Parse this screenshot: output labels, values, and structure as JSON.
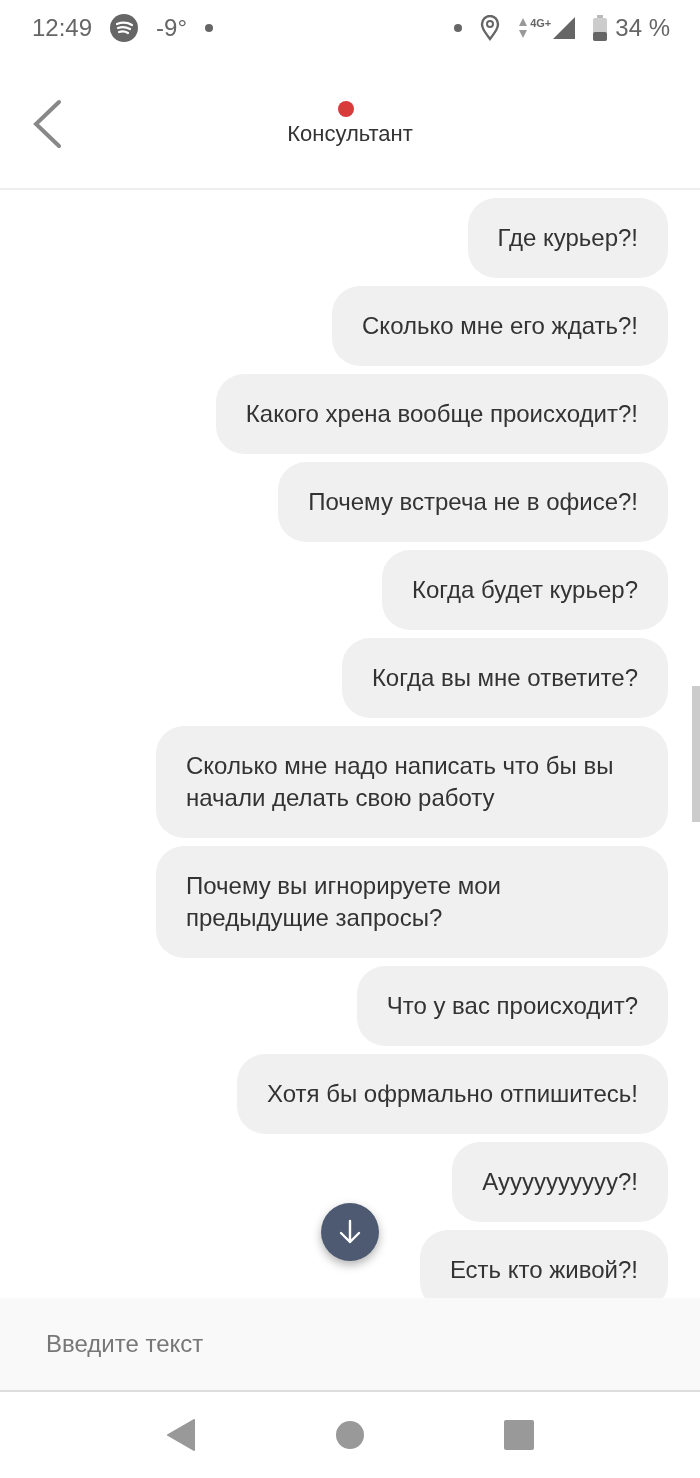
{
  "status_bar": {
    "time": "12:49",
    "temperature": "-9°",
    "network": "4G+",
    "battery": "34 %"
  },
  "header": {
    "title": "Консультант",
    "unread": true
  },
  "messages": [
    {
      "text": "Где курьер?!"
    },
    {
      "text": "Сколько мне его ждать?!"
    },
    {
      "text": "Какого хрена вообще происходит?!"
    },
    {
      "text": "Почему встреча не в офисе?!"
    },
    {
      "text": "Когда будет курьер?"
    },
    {
      "text": "Когда вы мне ответите?"
    },
    {
      "text": "Сколько мне надо написать что бы вы начали делать свою работу"
    },
    {
      "text": "Почему вы игнорируете мои предыдущие запросы?"
    },
    {
      "text": "Что у вас происходит?"
    },
    {
      "text": "Хотя бы офрмально отпишитесь!"
    },
    {
      "text": "Ауууууууууу?!"
    },
    {
      "text": "Есть кто живой?!"
    }
  ],
  "composer": {
    "placeholder": "Введите текст"
  }
}
